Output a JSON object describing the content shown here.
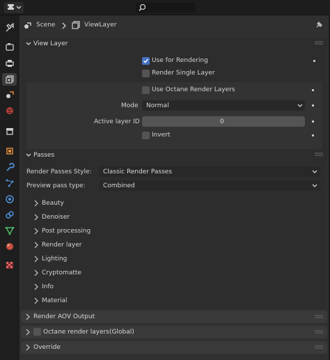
{
  "header": {
    "breadcrumb_scene": "Scene",
    "breadcrumb_viewlayer": "ViewLayer"
  },
  "view_layer": {
    "title": "View Layer",
    "use_for_rendering": "Use for Rendering",
    "render_single_layer": "Render Single Layer",
    "use_octane_render_layers": "Use Octane Render Layers",
    "mode_label": "Mode",
    "mode_value": "Normal",
    "active_layer_label": "Active layer ID",
    "active_layer_value": "0",
    "invert": "Invert"
  },
  "passes": {
    "title": "Passes",
    "render_passes_style_label": "Render Passes Style:",
    "render_passes_style_value": "Classic Render Passes",
    "preview_pass_label": "Preview pass type:",
    "preview_pass_value": "Combined",
    "items": [
      "Beauty",
      "Denoiser",
      "Post processing",
      "Render layer",
      "Lighting",
      "Cryptomatte",
      "Info",
      "Material"
    ]
  },
  "bottom_panels": {
    "render_aov": "Render AOV Output",
    "octane_render_layers_global": "Octane render layers(Global)",
    "override": "Override"
  },
  "colors": {
    "accent_checkbox": "#4672c4",
    "panel_bg": "#303030"
  }
}
